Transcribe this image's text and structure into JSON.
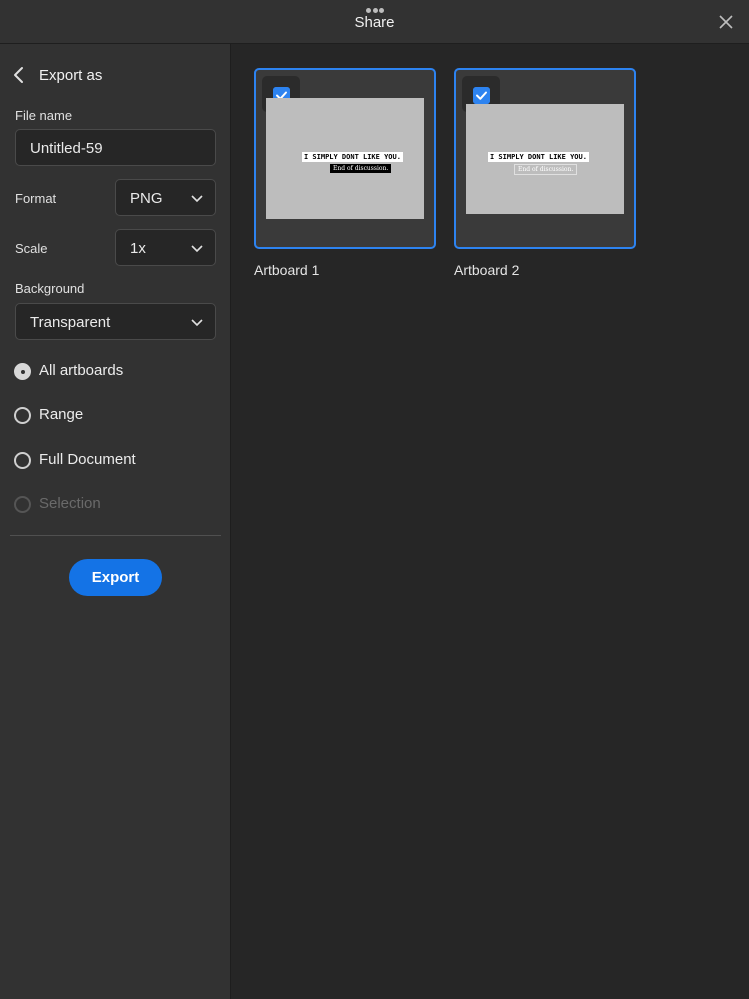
{
  "topbar": {
    "title": "Share"
  },
  "panel": {
    "heading": "Export as",
    "file_name_label": "File name",
    "file_name_value": "Untitled-59",
    "format_label": "Format",
    "format_value": "PNG",
    "scale_label": "Scale",
    "scale_value": "1x",
    "background_label": "Background",
    "background_value": "Transparent",
    "range_options": [
      {
        "label": "All artboards",
        "selected": true,
        "enabled": true
      },
      {
        "label": "Range",
        "selected": false,
        "enabled": true
      },
      {
        "label": "Full Document",
        "selected": false,
        "enabled": true
      },
      {
        "label": "Selection",
        "selected": false,
        "enabled": false
      }
    ],
    "export_label": "Export"
  },
  "artboards": [
    {
      "name": "Artboard 1",
      "checked": true,
      "caption_main": "I SIMPLY DONT LIKE YOU.",
      "caption_sub": "End of discussion."
    },
    {
      "name": "Artboard 2",
      "checked": true,
      "caption_main": "I SIMPLY DONT LIKE YOU.",
      "caption_sub": "End of discussion."
    }
  ],
  "colors": {
    "accent": "#1473e6",
    "selection_border": "#2d83f0"
  }
}
